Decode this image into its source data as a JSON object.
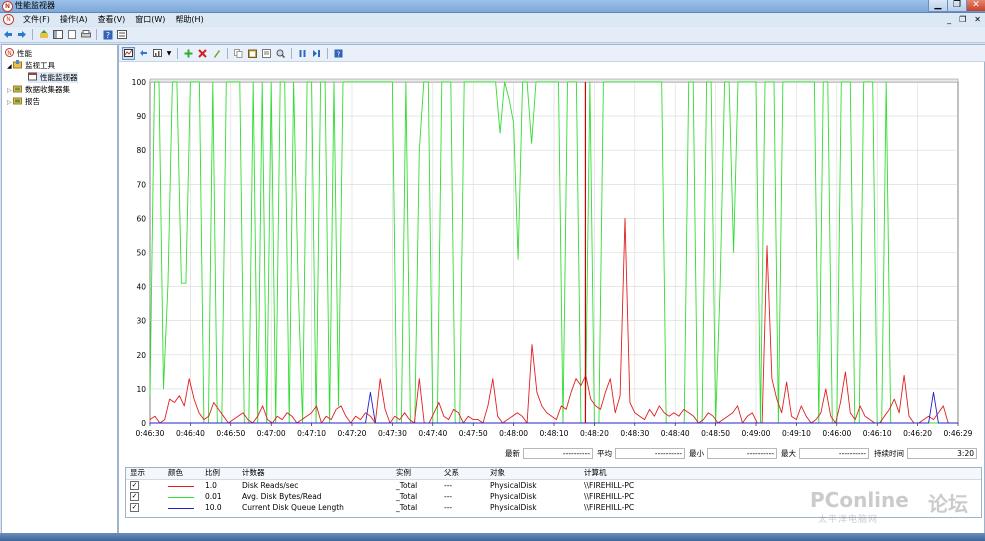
{
  "window": {
    "title": "性能监视器",
    "min": "▁",
    "max": "❐",
    "close": "✕"
  },
  "menu": {
    "items": [
      "文件(F)",
      "操作(A)",
      "查看(V)",
      "窗口(W)",
      "帮助(H)"
    ],
    "right": [
      "_",
      "❐",
      "✕"
    ]
  },
  "tree": {
    "root": "性能",
    "tools": "监视工具",
    "perfmon": "性能监视器",
    "collector": "数据收集器集",
    "reports": "报告"
  },
  "chart_data": {
    "type": "line",
    "ylim": [
      0,
      100
    ],
    "yticks": [
      "100",
      "90",
      "80",
      "70",
      "60",
      "50",
      "40",
      "30",
      "20",
      "10",
      "0"
    ],
    "xticks": [
      "0:46:30",
      "0:46:40",
      "0:46:50",
      "0:47:00",
      "0:47:10",
      "0:47:20",
      "0:47:30",
      "0:47:40",
      "0:47:50",
      "0:48:00",
      "0:48:10",
      "0:48:20",
      "0:48:30",
      "0:48:40",
      "0:48:50",
      "0:49:00",
      "0:49:10",
      "0:46:00",
      "0:46:10",
      "0:46:20",
      "0:46:29"
    ],
    "current_time_marker_index": 97,
    "series": [
      {
        "name": "Avg. Disk Bytes/Read",
        "color": "#33dd33",
        "values": [
          8,
          100,
          100,
          10,
          41,
          100,
          100,
          41,
          41,
          100,
          100,
          100,
          0,
          0,
          100,
          0,
          0,
          100,
          100,
          100,
          100,
          0,
          0,
          100,
          0,
          100,
          0,
          100,
          0,
          100,
          100,
          0,
          100,
          41,
          0,
          100,
          100,
          0,
          100,
          100,
          0,
          100,
          5,
          100,
          100,
          100,
          100,
          100,
          100,
          100,
          100,
          100,
          100,
          100,
          100,
          0,
          0,
          100,
          0,
          0,
          80,
          100,
          100,
          0,
          0,
          100,
          100,
          100,
          0,
          0,
          100,
          100,
          100,
          100,
          100,
          100,
          100,
          100,
          85,
          100,
          95,
          88,
          48,
          100,
          100,
          82,
          100,
          100,
          100,
          100,
          100,
          100,
          0,
          100,
          100,
          100,
          0,
          0,
          100,
          0,
          0,
          100,
          100,
          100,
          100,
          100,
          100,
          100,
          100,
          100,
          100,
          100,
          100,
          100,
          100,
          0,
          0,
          0,
          0,
          0,
          100,
          100,
          0,
          0,
          100,
          100,
          0,
          40,
          100,
          100,
          50,
          100,
          100,
          100,
          100,
          100,
          0,
          100,
          100,
          100,
          0,
          100,
          100,
          100,
          100,
          100,
          100,
          100,
          100,
          0,
          100,
          100,
          0,
          0,
          100,
          100,
          100,
          0,
          0,
          100,
          100,
          100,
          0,
          0,
          100,
          0,
          0,
          0,
          0,
          0,
          0,
          0,
          0,
          0,
          0,
          0,
          0,
          0,
          0,
          0,
          0
        ]
      },
      {
        "name": "Disk Reads/sec",
        "color": "#e02020",
        "values": [
          1,
          2,
          0,
          1,
          7,
          6,
          8,
          5,
          13,
          7,
          3,
          1,
          2,
          6,
          4,
          2,
          0,
          1,
          2,
          3,
          1,
          0,
          2,
          5,
          1,
          0,
          2,
          1,
          3,
          2,
          0,
          1,
          2,
          3,
          5,
          0,
          2,
          1,
          4,
          5,
          2,
          0,
          2,
          1,
          3,
          2,
          0,
          13,
          4,
          0,
          2,
          1,
          3,
          1,
          0,
          13,
          0,
          0,
          3,
          6,
          2,
          1,
          4,
          3,
          0,
          2,
          1,
          1,
          0,
          5,
          13,
          2,
          0,
          1,
          2,
          3,
          2,
          0,
          23,
          9,
          5,
          3,
          2,
          1,
          5,
          4,
          9,
          13,
          11,
          14,
          7,
          5,
          4,
          9,
          13,
          3,
          8,
          60,
          6,
          3,
          2,
          1,
          4,
          2,
          5,
          3,
          2,
          3,
          2,
          4,
          3,
          2,
          0,
          1,
          3,
          2,
          0,
          1,
          2,
          3,
          5,
          0,
          2,
          3,
          0,
          0,
          52,
          13,
          7,
          3,
          12,
          2,
          1,
          5,
          2,
          0,
          1,
          3,
          10,
          2,
          0,
          6,
          15,
          3,
          1,
          5,
          2,
          1,
          0,
          0,
          2,
          4,
          7,
          3,
          14,
          2,
          0,
          0,
          1,
          2,
          1,
          3,
          5,
          0,
          0,
          0
        ]
      },
      {
        "name": "Current Disk Queue Length",
        "color": "#2020d0",
        "values": [
          0,
          0,
          0,
          0,
          0,
          0,
          0,
          0,
          0,
          0,
          0,
          0,
          0,
          0,
          0,
          0,
          0,
          0,
          0,
          0,
          0,
          0,
          0,
          0,
          0,
          0,
          0,
          0,
          0,
          0,
          0,
          0,
          0,
          0,
          0,
          0,
          0,
          0,
          0,
          0,
          0,
          0,
          0,
          0,
          0,
          9,
          0,
          0,
          0,
          0,
          0,
          0,
          0,
          0,
          0,
          0,
          0,
          0,
          0,
          0,
          0,
          0,
          0,
          0,
          0,
          0,
          0,
          0,
          0,
          0,
          0,
          0,
          0,
          0,
          0,
          0,
          0,
          0,
          0,
          0,
          0,
          0,
          0,
          0,
          0,
          0,
          0,
          0,
          0,
          0,
          0,
          0,
          0,
          0,
          0,
          0,
          0,
          0,
          0,
          0,
          0,
          0,
          0,
          0,
          0,
          0,
          0,
          0,
          0,
          0,
          0,
          0,
          0,
          0,
          0,
          0,
          0,
          0,
          0,
          0,
          0,
          0,
          0,
          0,
          0,
          0,
          0,
          0,
          0,
          0,
          0,
          0,
          0,
          0,
          0,
          0,
          0,
          0,
          0,
          0,
          0,
          0,
          0,
          0,
          0,
          0,
          0,
          0,
          0,
          0,
          0,
          0,
          0,
          0,
          0,
          0,
          0,
          0,
          0,
          0,
          9,
          0,
          0,
          0,
          0,
          0
        ]
      }
    ]
  },
  "stats": {
    "last_label": "最新",
    "last_value": "----------",
    "avg_label": "平均",
    "avg_value": "----------",
    "min_label": "最小",
    "min_value": "----------",
    "max_label": "最大",
    "max_value": "----------",
    "duration_label": "持续时间",
    "duration_value": "3:20"
  },
  "legend": {
    "headers": {
      "show": "显示",
      "color": "颜色",
      "scale": "比例",
      "counter": "计数器",
      "instance": "实例",
      "parent": "父系",
      "object": "对象",
      "computer": "计算机"
    },
    "rows": [
      {
        "color": "#e02020",
        "scale": "1.0",
        "counter": "Disk Reads/sec",
        "instance": "_Total",
        "parent": "---",
        "object": "PhysicalDisk",
        "computer": "\\\\FIREHILL-PC"
      },
      {
        "color": "#33dd33",
        "scale": "0.01",
        "counter": "Avg. Disk Bytes/Read",
        "instance": "_Total",
        "parent": "---",
        "object": "PhysicalDisk",
        "computer": "\\\\FIREHILL-PC"
      },
      {
        "color": "#2020d0",
        "scale": "10.0",
        "counter": "Current Disk Queue Length",
        "instance": "_Total",
        "parent": "---",
        "object": "PhysicalDisk",
        "computer": "\\\\FIREHILL-PC"
      }
    ]
  },
  "watermark": {
    "brand": "PConline",
    "forum": "论坛",
    "sub": "太平洋电脑网"
  }
}
